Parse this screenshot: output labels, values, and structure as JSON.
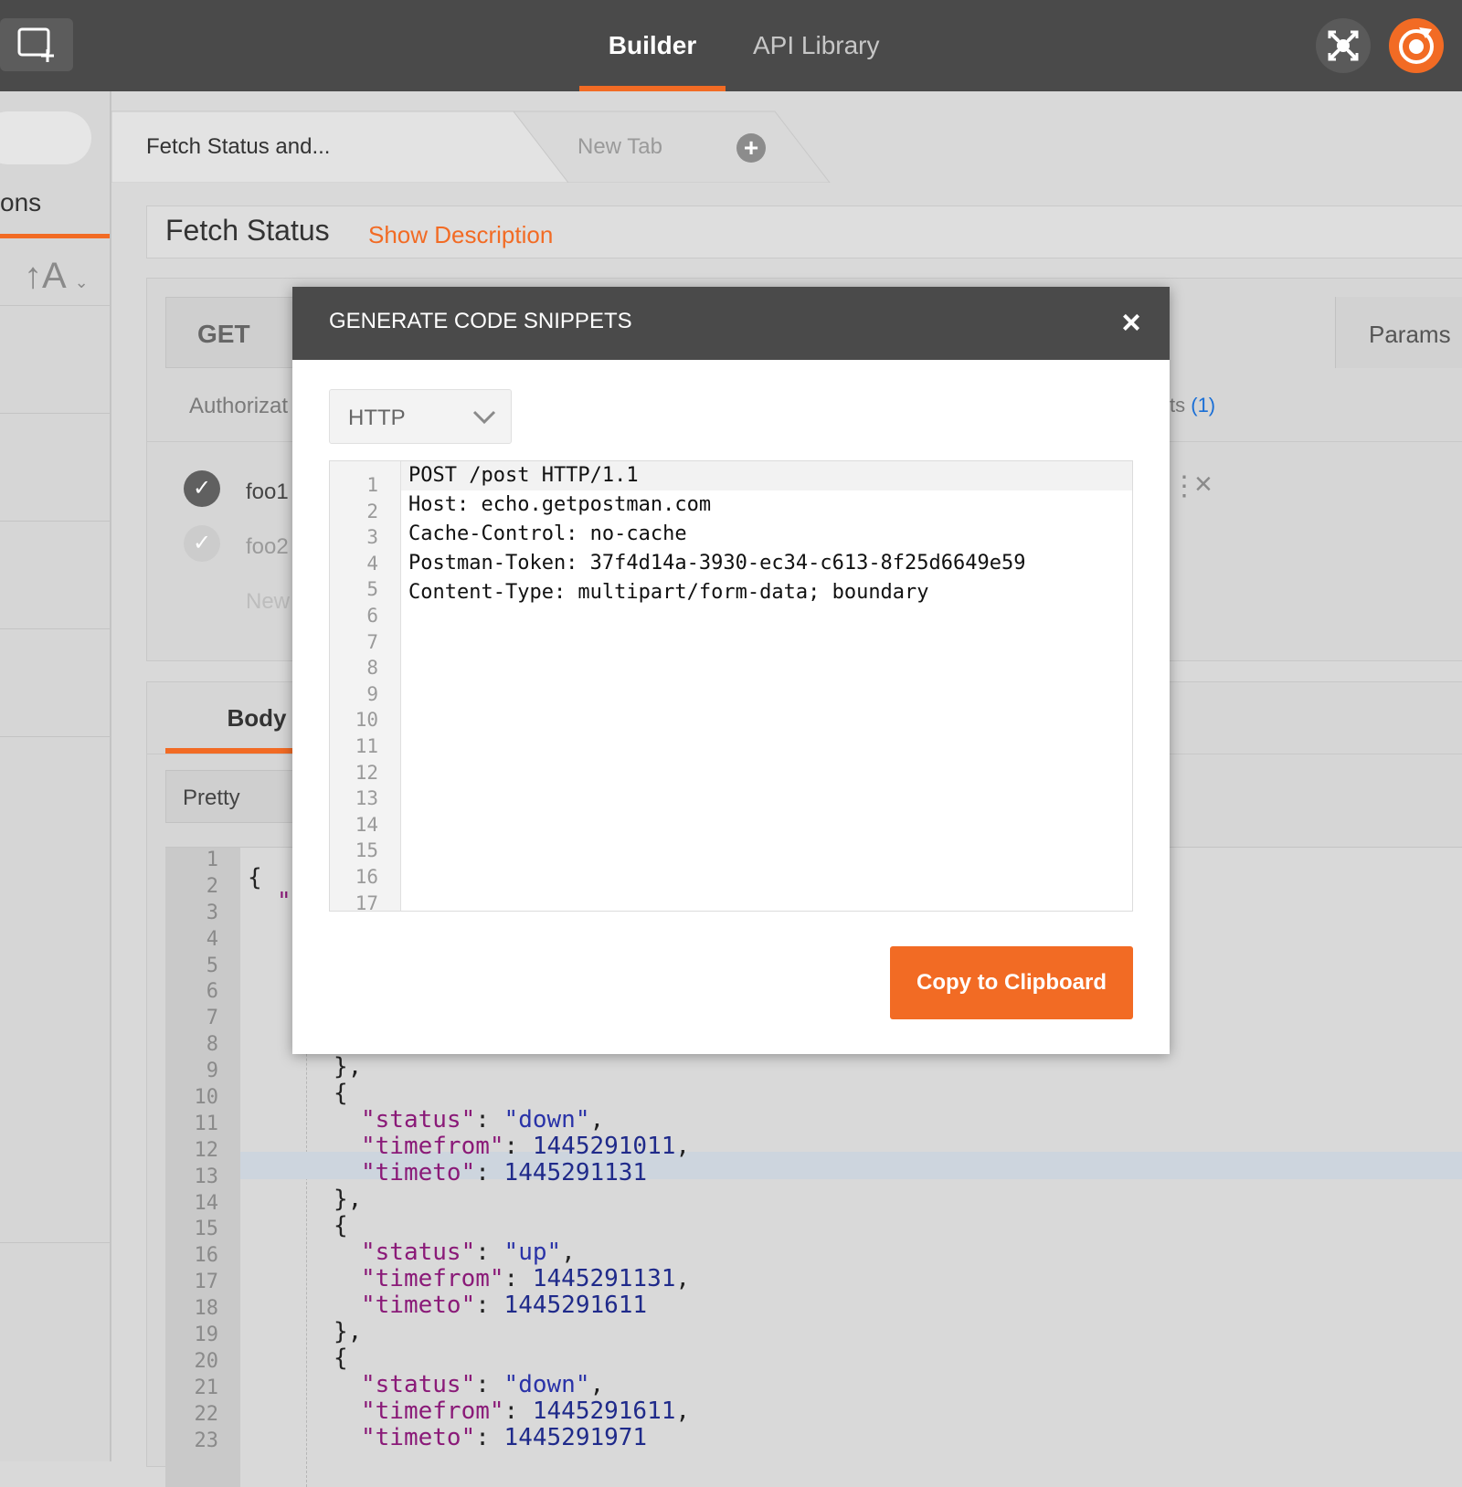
{
  "header": {
    "nav": {
      "builder": "Builder",
      "api_library": "API Library"
    },
    "icons": {
      "new": "new-window-icon",
      "sync": "sync-icon",
      "interceptor": "interceptor-icon"
    },
    "accent_color": "#f26b24"
  },
  "sidebar": {
    "partial_label": "ons",
    "sort_label": "↑A"
  },
  "tabs": [
    {
      "label": "Fetch Status and..."
    },
    {
      "label": "New Tab"
    }
  ],
  "request": {
    "name": "Fetch Status",
    "show_description": "Show Description",
    "method": "GET",
    "params_label": "Params",
    "authorization_label": "Authorizat",
    "tests_label": "sts",
    "tests_count": "(1)",
    "rows": [
      "foo1",
      "foo2",
      "New"
    ]
  },
  "response": {
    "body_tab": "Body",
    "pretty_label": "Pretty",
    "line_numbers": [
      "1",
      "2",
      "3",
      "4",
      "5",
      "6",
      "7",
      "8",
      "9",
      "10",
      "11",
      "12",
      "13",
      "14",
      "15",
      "16",
      "17",
      "18",
      "19",
      "20",
      "21",
      "22",
      "23"
    ],
    "open_brace": "{",
    "blocks": [
      {
        "status": "\"down\"",
        "timefrom": "1445291011",
        "timeto": "1445291131"
      },
      {
        "status": "\"up\"",
        "timefrom": "1445291131",
        "timeto": "1445291611"
      },
      {
        "status": "\"down\"",
        "timefrom": "1445291611",
        "timeto": "1445291971"
      }
    ]
  },
  "modal": {
    "title": "GENERATE CODE SNIPPETS",
    "language": "HTTP",
    "line_numbers": [
      "1",
      "2",
      "3",
      "4",
      "5",
      "6",
      "7",
      "8",
      "9",
      "10",
      "11",
      "12",
      "13",
      "14",
      "15",
      "16",
      "17"
    ],
    "code_lines": [
      "POST /post HTTP/1.1",
      "Host: echo.getpostman.com",
      "Cache-Control: no-cache",
      "Postman-Token: 37f4d14a-3930-ec34-c613-8f25d6649e59",
      "Content-Type: multipart/form-data; boundary"
    ],
    "copy_button": "Copy to Clipboard"
  }
}
